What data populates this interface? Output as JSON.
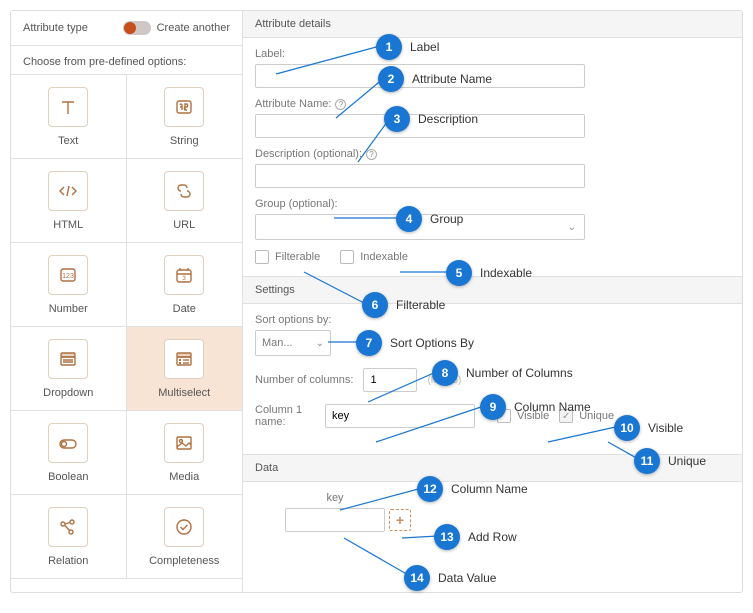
{
  "left": {
    "title": "Attribute type",
    "create_another": "Create another",
    "choose_label": "Choose from pre-defined options:",
    "types": [
      {
        "key": "text",
        "label": "Text"
      },
      {
        "key": "string",
        "label": "String"
      },
      {
        "key": "html",
        "label": "HTML"
      },
      {
        "key": "url",
        "label": "URL"
      },
      {
        "key": "number",
        "label": "Number"
      },
      {
        "key": "date",
        "label": "Date"
      },
      {
        "key": "dropdown",
        "label": "Dropdown"
      },
      {
        "key": "multiselect",
        "label": "Multiselect"
      },
      {
        "key": "boolean",
        "label": "Boolean"
      },
      {
        "key": "media",
        "label": "Media"
      },
      {
        "key": "relation",
        "label": "Relation"
      },
      {
        "key": "completeness",
        "label": "Completeness"
      }
    ]
  },
  "details": {
    "header": "Attribute details",
    "label_field": "Label:",
    "name_field": "Attribute Name:",
    "desc_field": "Description (optional):",
    "group_field": "Group (optional):",
    "filterable": "Filterable",
    "indexable": "Indexable"
  },
  "settings": {
    "header": "Settings",
    "sort_label": "Sort options by:",
    "sort_value": "Man...",
    "numcols_label": "Number of columns:",
    "numcols_value": "1",
    "numcols_hint": "(Max 5)",
    "col1_label": "Column 1 name:",
    "col1_value": "key",
    "visible": "Visible",
    "unique": "Unique"
  },
  "data": {
    "header": "Data",
    "col_header": "key"
  },
  "callouts": {
    "c1": "Label",
    "c2": "Attribute Name",
    "c3": "Description",
    "c4": "Group",
    "c5": "Indexable",
    "c6": "Filterable",
    "c7": "Sort Options By",
    "c8": "Number of Columns",
    "c9": "Column Name",
    "c10": "Visible",
    "c11": "Unique",
    "c12": "Column Name",
    "c13": "Add Row",
    "c14": "Data Value"
  }
}
